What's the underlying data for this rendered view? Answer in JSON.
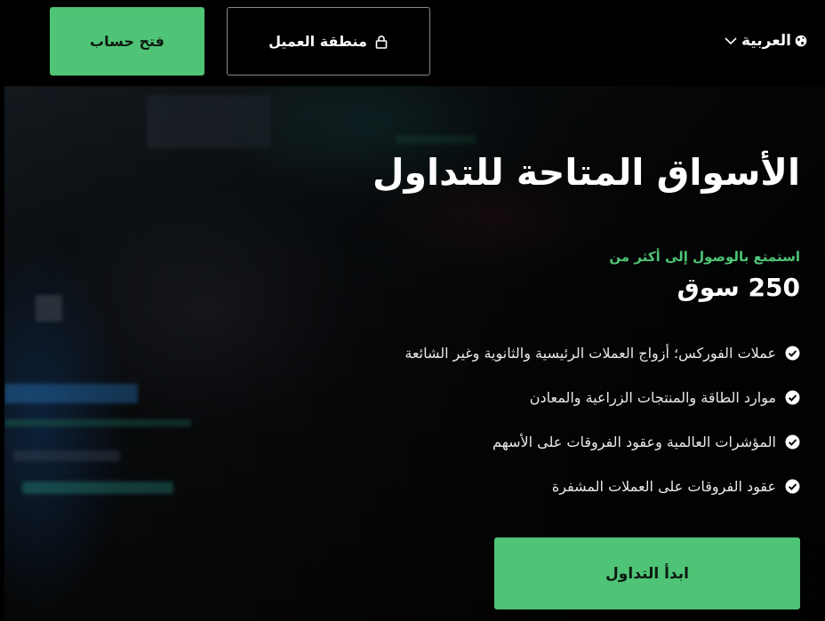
{
  "header": {
    "open_account_label": "فتح حساب",
    "client_area_label": "منطقة العميل",
    "language_label": "العربية",
    "icons": [
      "lock-icon",
      "globe-icon",
      "chevron-down-icon"
    ]
  },
  "hero": {
    "title": "الأسواق المتاحة للتداول",
    "subtitle": "استمتع بالوصول إلى أكثر من",
    "count": "250 سوق",
    "features": [
      "عملات الفوركس؛ أزواج العملات الرئيسية والثانوية وغير الشائعة",
      "موارد الطاقة والمنتجات الزراعية والمعادن",
      "المؤشرات العالمية وعقود الفروقات على الأسهم",
      "عقود الفروقات على العملات المشفرة"
    ],
    "start_label": "ابدأ التداول"
  },
  "colors": {
    "accent": "#4fc476",
    "background": "#000000",
    "text": "#ffffff"
  }
}
